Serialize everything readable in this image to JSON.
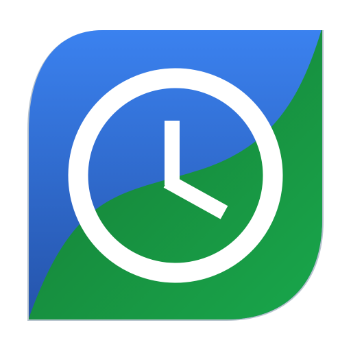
{
  "app_icon": {
    "name": "clock-icon",
    "colors": {
      "blue_light": "#3b82f0",
      "blue_dark": "#2452a8",
      "green_dark": "#157a34",
      "green_light": "#19a84c",
      "rim": "#b7c3ce",
      "face": "#ffffff"
    }
  }
}
